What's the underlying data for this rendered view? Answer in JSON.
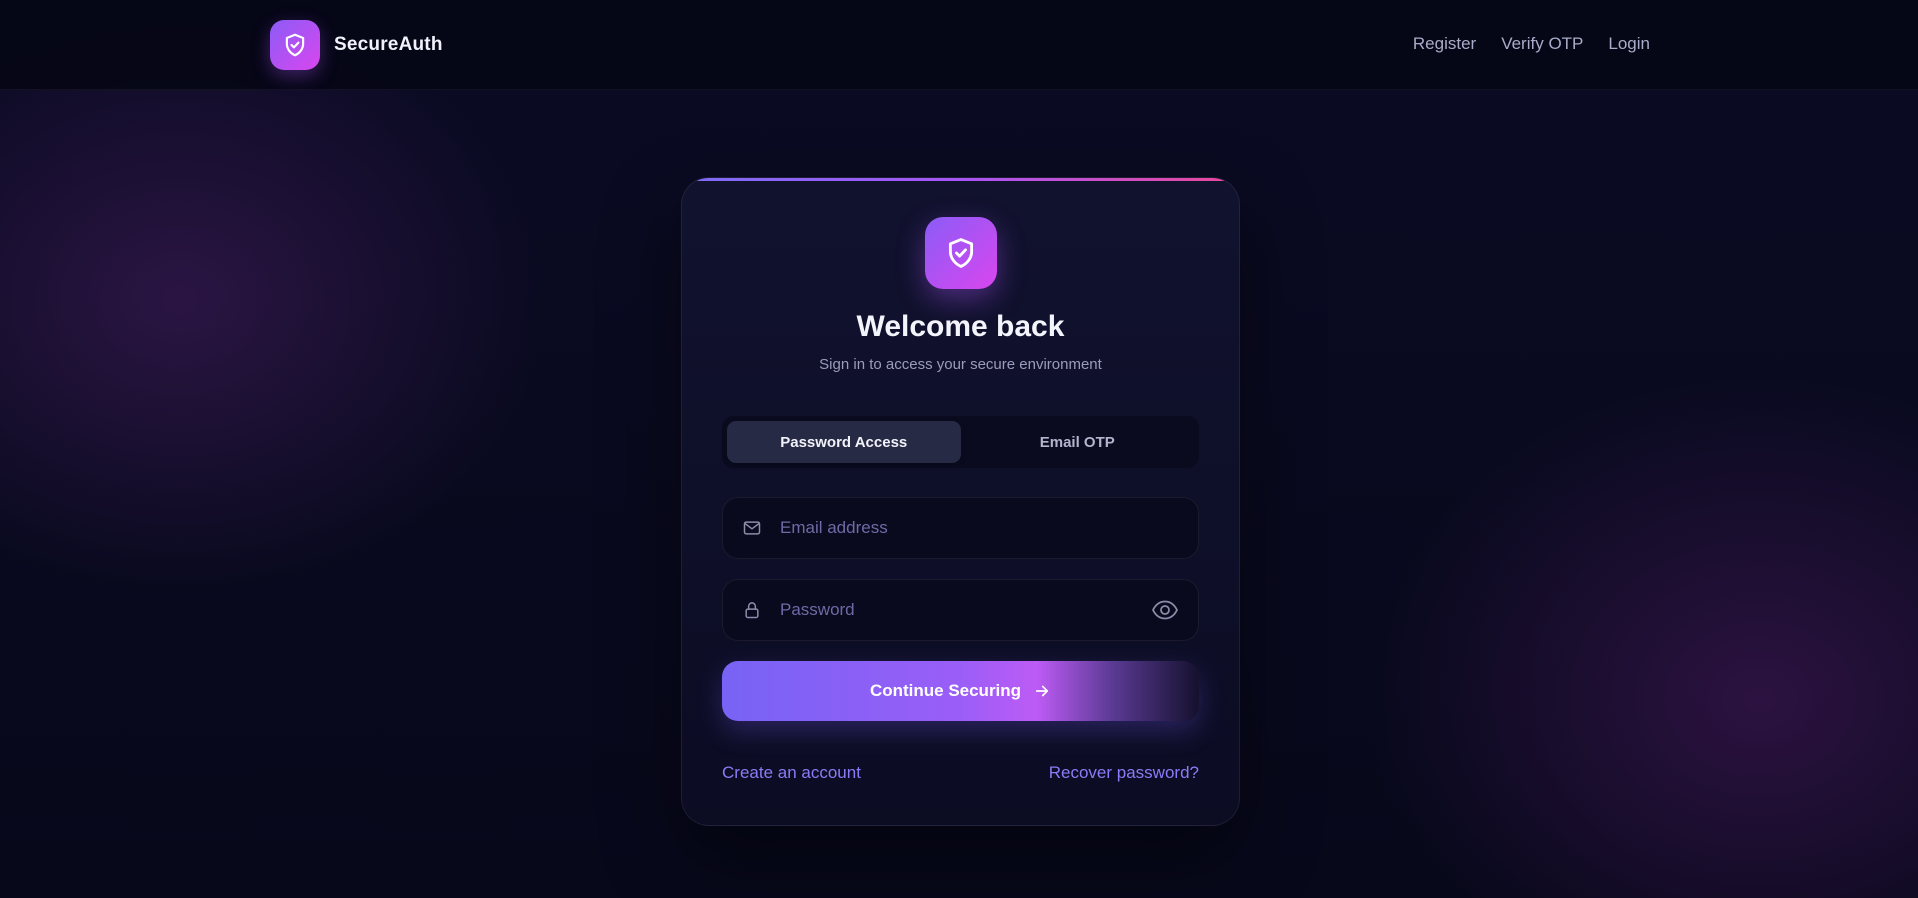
{
  "header": {
    "brand_name": "SecureAuth",
    "nav": [
      {
        "label": "Register"
      },
      {
        "label": "Verify OTP"
      },
      {
        "label": "Login"
      }
    ]
  },
  "card": {
    "title": "Welcome back",
    "subtitle": "Sign in to access your secure environment",
    "tabs": [
      {
        "label": "Password Access",
        "active": true
      },
      {
        "label": "Email OTP",
        "active": false
      }
    ],
    "email": {
      "placeholder": "Email address",
      "value": ""
    },
    "password": {
      "placeholder": "Password",
      "value": ""
    },
    "submit_label": "Continue Securing",
    "create_account": "Create an account",
    "recover_password": "Recover password?"
  },
  "icons": {
    "brand": "shield-check-icon",
    "email": "mail-icon",
    "password": "lock-icon",
    "toggle_visibility": "eye-icon",
    "submit": "arrow-right-icon"
  },
  "colors": {
    "accent_start": "#8b5cf6",
    "accent_end": "#d946ef",
    "link": "#8a7cf6",
    "background": "#07081a"
  }
}
